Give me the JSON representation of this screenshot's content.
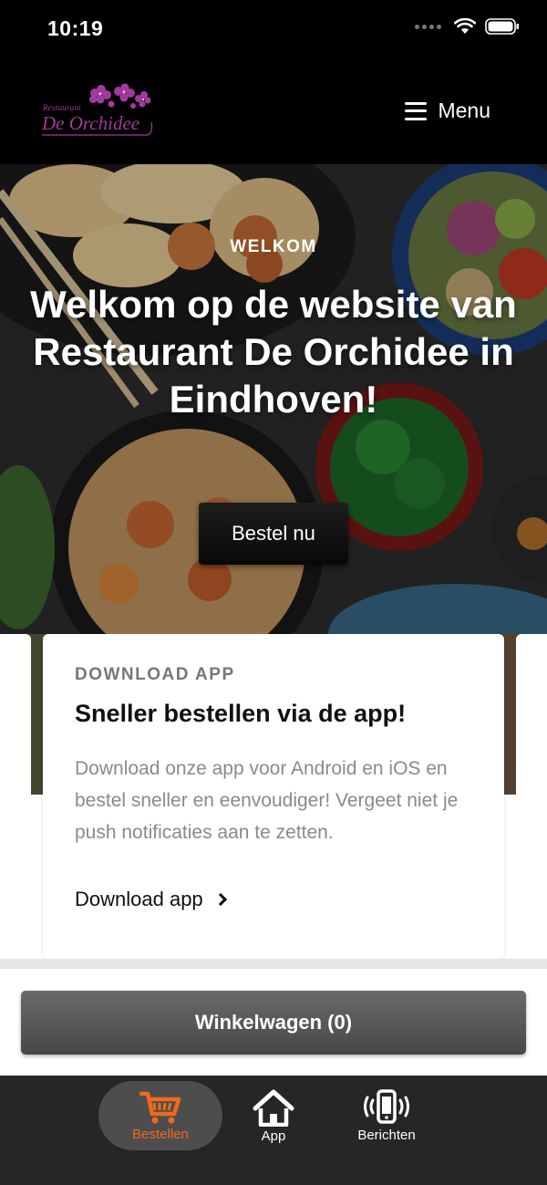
{
  "status_bar": {
    "time": "10:19"
  },
  "header": {
    "logo_text_top": "Restaurant",
    "logo_text_main": "De Orchidee",
    "menu_label": "Menu"
  },
  "hero": {
    "eyebrow": "WELKOM",
    "title": "Welkom op de website van Restaurant De Orchidee in Eindhoven!",
    "cta_label": "Bestel nu"
  },
  "card": {
    "eyebrow": "DOWNLOAD APP",
    "title": "Sneller bestellen via de app!",
    "body": "Download onze app voor Android en iOS en bestel sneller en eenvoudiger! Vergeet niet je push notificaties aan te zetten.",
    "link_label": "Download app"
  },
  "cart": {
    "label": "Winkelwagen (0)"
  },
  "bottom_nav": {
    "items": [
      {
        "label": "Bestellen",
        "icon": "cart-icon",
        "active": true
      },
      {
        "label": "App",
        "icon": "home-icon",
        "active": false
      },
      {
        "label": "Berichten",
        "icon": "phone-vibrate-icon",
        "active": false
      }
    ]
  },
  "colors": {
    "accent": "#f06a1d",
    "logo": "#a23a9e",
    "nav_bg": "#262626"
  }
}
